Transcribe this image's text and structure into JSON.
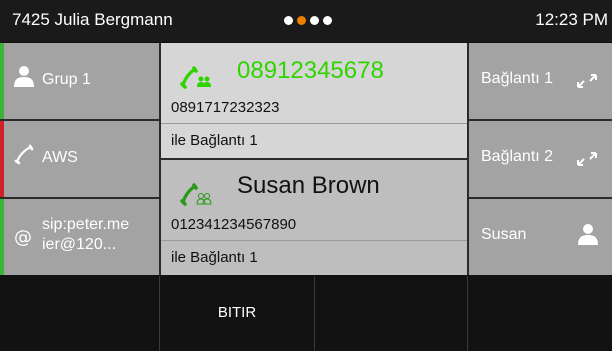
{
  "status": {
    "user": "7425 Julia Bergmann",
    "time": "12:23 PM",
    "pages": 4,
    "active_page": 2,
    "accent_color": "#ef7d00"
  },
  "left_keys": [
    {
      "label": "Grup 1",
      "icon": "user-icon",
      "indicator_color": "#3cb43c"
    },
    {
      "label": "AWS",
      "icon": "phone-handset-icon",
      "indicator_color": "#d0202a"
    },
    {
      "label": "sip:peter.me ier@120...",
      "line1": "sip:peter.me",
      "line2": "ier@120...",
      "icon": "at-icon",
      "indicator_color": "#3cb43c"
    }
  ],
  "calls": {
    "active": {
      "name": "08912345678",
      "number": "0891717232323",
      "via": "ile Bağlantı 1",
      "color": "#2fd400"
    },
    "held": {
      "name": "Susan Brown",
      "number": "012341234567890",
      "via": "ile Bağlantı 1"
    }
  },
  "right_keys": [
    {
      "label": "Bağlantı 1",
      "icon": "transfer-arrows-icon"
    },
    {
      "label": "Bağlantı 2",
      "icon": "transfer-arrows-icon"
    },
    {
      "label": "Susan",
      "icon": "user-icon"
    }
  ],
  "softkeys": [
    "",
    "BITIR",
    "",
    ""
  ]
}
